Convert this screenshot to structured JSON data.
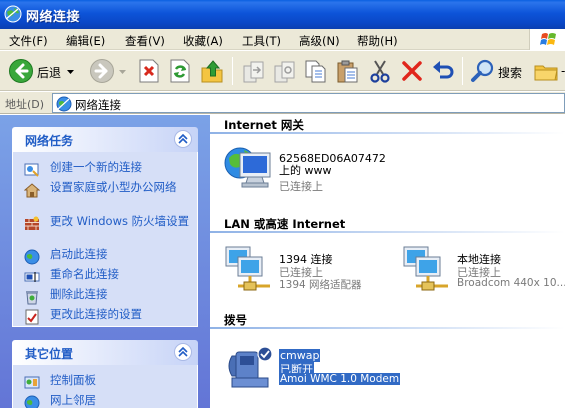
{
  "window": {
    "title": "网络连接"
  },
  "menu": [
    "文件(F)",
    "编辑(E)",
    "查看(V)",
    "收藏(A)",
    "工具(T)",
    "高级(N)",
    "帮助(H)"
  ],
  "toolbar": {
    "back_label": "后退",
    "search_label": "搜索"
  },
  "address": {
    "label": "地址(D)",
    "value": "网络连接"
  },
  "left_panel": {
    "tasks_box": {
      "title": "网络任务",
      "items": [
        {
          "label": "创建一个新的连接",
          "icon": "new-connection-icon"
        },
        {
          "label": "设置家庭或小型办公网络",
          "icon": "home-network-icon"
        },
        {
          "label": "更改 Windows 防火墙设置",
          "icon": "firewall-icon"
        },
        {
          "label": "启动此连接",
          "icon": "enable-connection-icon"
        },
        {
          "label": "重命名此连接",
          "icon": "rename-icon"
        },
        {
          "label": "删除此连接",
          "icon": "delete-connection-icon"
        },
        {
          "label": "更改此连接的设置",
          "icon": "connection-settings-icon"
        }
      ]
    },
    "other_box": {
      "title": "其它位置",
      "items": [
        {
          "label": "控制面板",
          "icon": "control-panel-icon"
        },
        {
          "label": "网上邻居",
          "icon": "network-places-icon"
        }
      ]
    }
  },
  "groups": {
    "internet": {
      "title": "Internet 网关",
      "items": [
        {
          "name": "62568ED06A07472 上的 www",
          "status": "已连接上"
        }
      ]
    },
    "lan": {
      "title": "LAN 或高速 Internet",
      "items": [
        {
          "name": "1394 连接",
          "status": "已连接上",
          "device": "1394 网络适配器"
        },
        {
          "name": "本地连接",
          "status": "已连接上",
          "device": "Broadcom 440x 10..."
        }
      ]
    },
    "dialup": {
      "title": "拨号",
      "items": [
        {
          "name": "cmwap",
          "status": "已断开",
          "device": "Amoi WMC 1.0 Modem"
        }
      ]
    }
  }
}
